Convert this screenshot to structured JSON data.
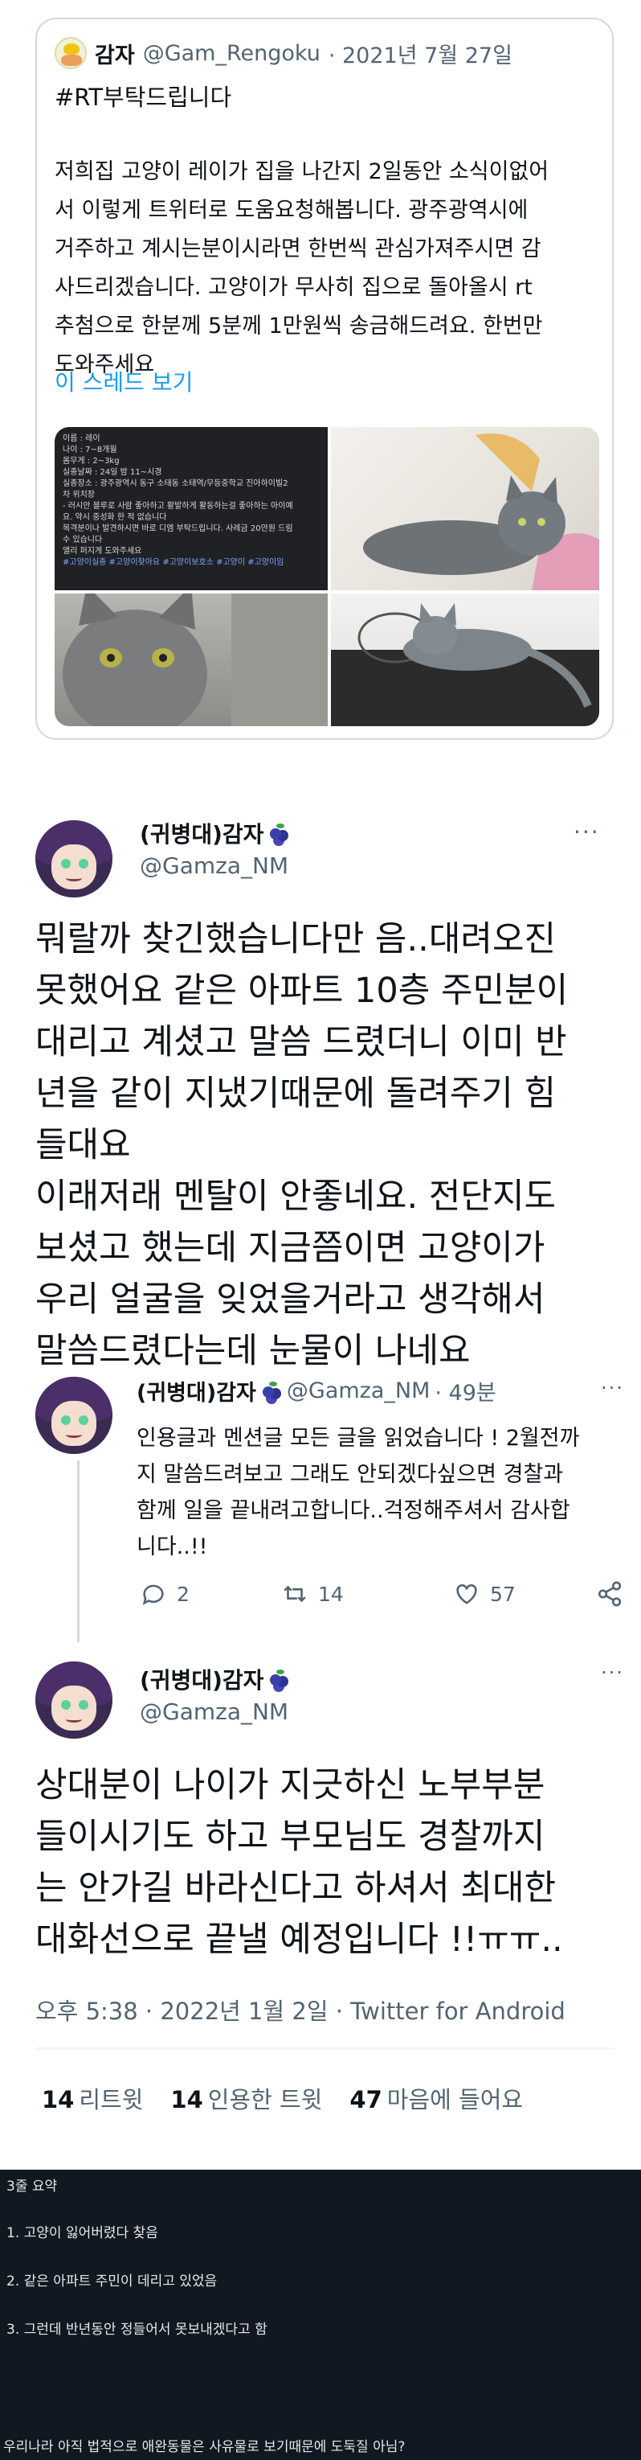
{
  "quote": {
    "name": "감자",
    "handle": "@Gam_Rengoku",
    "date": "· 2021년 7월 27일",
    "hashtag": "#RT부탁드립니다",
    "lines": [
      "저희집 고양이 레이가 집을 나간지 2일동안 소식이없어",
      "서 이렇게 트위터로 도움요청해봅니다. 광주광역시에",
      "거주하고 계시는분이시라면 한번씩 관심가져주시면 감",
      "사드리겠습니다. 고양이가 무사히 집으로 돌아올시 rt",
      "추첨으로 한분께 5분께 1만원씩 송금해드려요. 한번만",
      "도와주세요"
    ],
    "thread_link": "이 스레드 보기",
    "info_card": [
      "이름 : 레이",
      "나이 : 7~8개월",
      "몸무게 : 2~3kg",
      "실종날짜 : 24일 밤 11~시경",
      "실종장소 : 광주광역시 동구 소태동 소태역/무등중학교 진아하이빌2",
      "차 위치장",
      "- 러시안 블루로 사람 좋아하고 활발하게 활동하는걸 좋아하는 아이예",
      "요. 약시 중성화 한 적 없습니다",
      "목격분이나 발견하시면 바로 디엠 부탁드립니다. 사례금 20만원 드림",
      "수 있습니다",
      "앨리 퍼지게 도와주세요",
      "#고양이실종 #고양이찾아요 #고양이보호소 #고양이 #고양이임"
    ]
  },
  "main": {
    "name": "(귀병대)감자",
    "handle": "@Gamza_NM",
    "more": "···",
    "lines": [
      "뭐랄까 찾긴했습니다만 음..대려오진",
      "못했어요 같은 아파트 10층 주민분이",
      "대리고 계셨고 말씀 드렸더니 이미 반",
      "년을 같이 지냈기때문에 돌려주기 힘",
      "들대요",
      "이래저래 멘탈이 안좋네요. 전단지도",
      "보셨고 했는데 지금쯤이면 고양이가",
      "우리 얼굴을 잊었을거라고 생각해서",
      "말씀드렸다는데 눈물이 나네요"
    ]
  },
  "reply": {
    "name": "(귀병대)감자",
    "handle": "@Gamza_NM",
    "time": "· 49분",
    "more": "···",
    "lines": [
      "인용글과 멘션글 모든 글을 읽었습니다 ! 2월전까",
      "지 말씀드려보고 그래도 안되겠다싶으면 경찰과",
      "함께 일을 끝내려고합니다..걱정해주셔서 감사합",
      "니다..!!"
    ],
    "replies": "2",
    "retweets": "14",
    "likes": "57"
  },
  "final": {
    "name": "(귀병대)감자",
    "handle": "@Gamza_NM",
    "more": "···",
    "lines": [
      "상대분이 나이가 지긋하신 노부부분",
      "들이시기도 하고 부모님도 경찰까지",
      "는 안가길 바라신다고 하셔서 최대한",
      "대화선으로 끝낼 예정입니다 !!ㅠㅠ.."
    ],
    "meta": "오후 5:38 · 2022년 1월 2일 · Twitter for Android",
    "stats": {
      "retweets_count": "14",
      "retweets_label": "리트윗",
      "quotes_count": "14",
      "quotes_label": "인용한 트윗",
      "likes_count": "47",
      "likes_label": "마음에 들어요"
    }
  },
  "summary": {
    "title": "3줄 요약",
    "items": [
      "1. 고양이 잃어버렸다 찾음",
      "2. 같은 아파트 주민이 데리고 있었음",
      "3. 그런데 반년동안 정들어서 못보내겠다고 함"
    ],
    "footer": "우리나라 아직 법적으로 애완동물은 사유물로 보기때문에 도둑질 아님?"
  }
}
